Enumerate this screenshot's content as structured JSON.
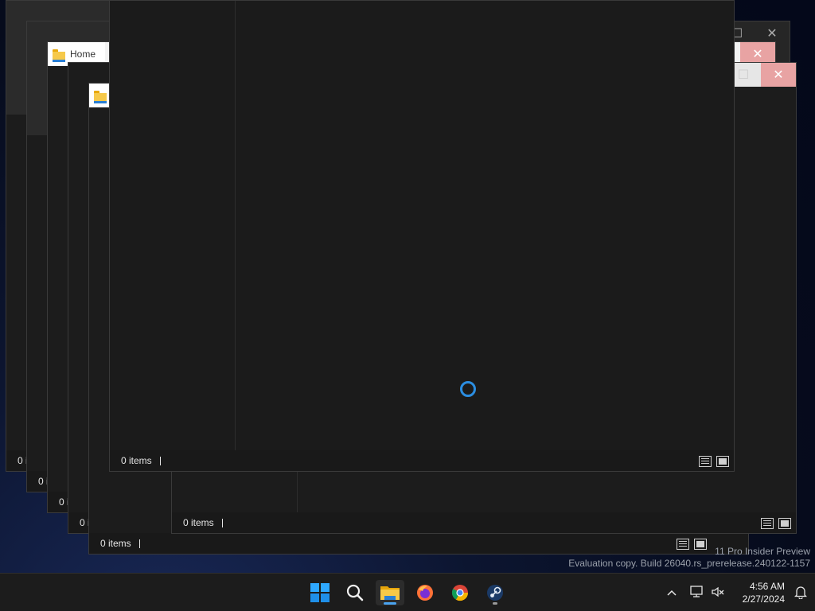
{
  "windows": [
    {
      "id": "w1",
      "status": "0 items"
    },
    {
      "id": "w2",
      "status": "0 items"
    },
    {
      "id": "w3",
      "status": "0 items",
      "tab": "Home"
    },
    {
      "id": "w4",
      "status": "0 items"
    },
    {
      "id": "w5",
      "status": "0 items"
    },
    {
      "id": "w6",
      "status": "0 items"
    },
    {
      "id": "w7",
      "status": "0 items"
    }
  ],
  "truncated_status": [
    "0 i",
    "0 i",
    "0 i"
  ],
  "watermark": {
    "line1": "11 Pro Insider Preview",
    "line2": "Evaluation copy. Build 26040.rs_prerelease.240122-1157"
  },
  "taskbar": {
    "apps": [
      {
        "name": "start",
        "icon": "windows-logo-icon"
      },
      {
        "name": "search",
        "icon": "search-icon"
      },
      {
        "name": "file-explorer",
        "icon": "folder-icon",
        "active": true
      },
      {
        "name": "firefox",
        "icon": "firefox-icon"
      },
      {
        "name": "chrome",
        "icon": "chrome-icon"
      },
      {
        "name": "steam",
        "icon": "steam-icon"
      }
    ],
    "clock": {
      "time": "4:56 AM",
      "date": "2/27/2024"
    }
  },
  "colors": {
    "accent": "#2b8de0",
    "window_bg": "#1c1c1c",
    "taskbar_bg": "#1c1c1c"
  }
}
